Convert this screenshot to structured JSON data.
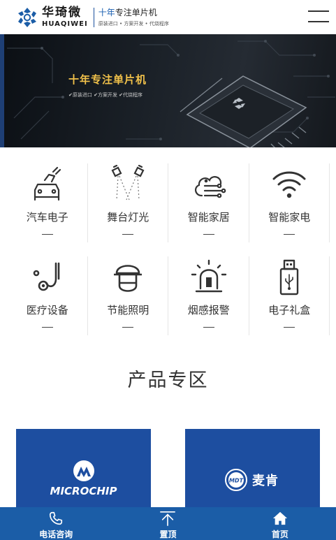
{
  "header": {
    "logo_cn": "华琦微",
    "logo_en": "HUAQIWEI",
    "slogan_accent": "十年",
    "slogan_rest": "专注单片机",
    "slogan_sub": "原装进口 • 方案开发 • 代烧程序",
    "menu_icon": "hamburger-menu-icon"
  },
  "banner": {
    "title": "十年专注单片机",
    "sub": "✔原装进口  ✔方案开发  ✔代烧程序"
  },
  "categories": [
    {
      "label": "汽车电子",
      "icon": "car-plug-icon"
    },
    {
      "label": "舞台灯光",
      "icon": "stage-lights-icon"
    },
    {
      "label": "智能家居",
      "icon": "cloud-circuit-icon"
    },
    {
      "label": "智能家电",
      "icon": "wifi-icon"
    },
    {
      "label": "医疗设备",
      "icon": "stethoscope-icon"
    },
    {
      "label": "节能照明",
      "icon": "lamp-icon"
    },
    {
      "label": "烟感报警",
      "icon": "alarm-light-icon"
    },
    {
      "label": "电子礼盒",
      "icon": "usb-drive-icon"
    }
  ],
  "products": {
    "title": "产品专区",
    "brands": [
      {
        "name": "MICROCHIP",
        "icon": "microchip-logo-icon"
      },
      {
        "name": "麦肯",
        "logo_text": "MDT",
        "icon": "mdt-logo-icon"
      }
    ]
  },
  "bottom_bar": [
    {
      "label": "电话咨询",
      "icon": "phone-icon"
    },
    {
      "label": "置顶",
      "icon": "to-top-icon"
    },
    {
      "label": "首页",
      "icon": "home-icon"
    }
  ],
  "colors": {
    "brand_blue": "#1d4ea0",
    "bar_blue": "#1b5da7",
    "banner_gold": "#f1c14a"
  }
}
